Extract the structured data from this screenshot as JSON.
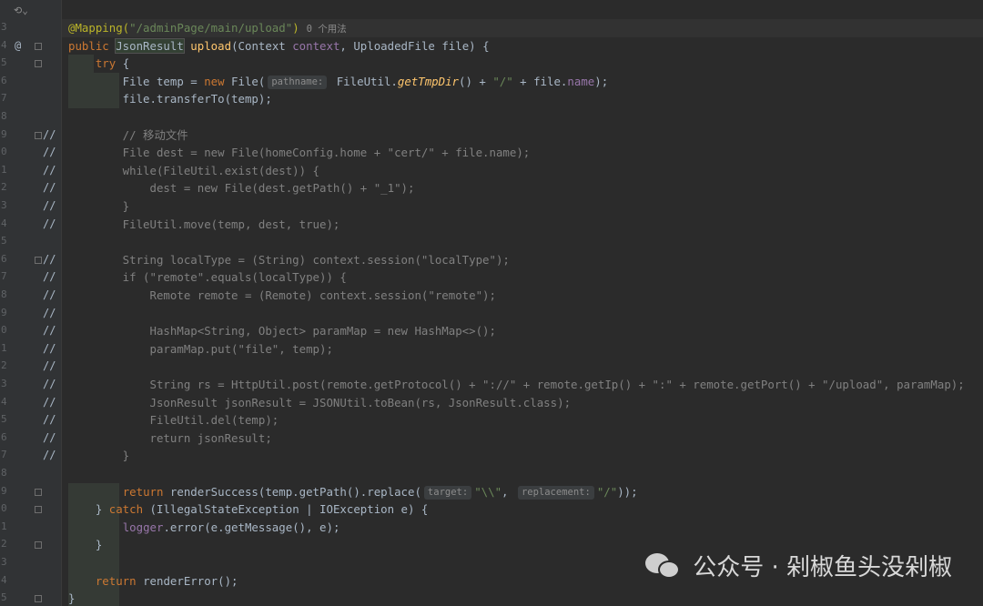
{
  "gutter": {
    "line_numbers": [
      "3",
      "4",
      "5",
      "6",
      "7",
      "7",
      "8",
      "9",
      "0",
      "1",
      "2",
      "3",
      "4",
      "5",
      "6",
      "7",
      "8",
      "9",
      "0",
      "1",
      "2",
      "3",
      "4",
      "5",
      "6",
      "7",
      "8",
      "9",
      "0",
      "1",
      "2",
      "3",
      "4"
    ],
    "at_marker": "@",
    "comment_marker": "//"
  },
  "toolbar": {
    "icon_text": "⟲⌄"
  },
  "lines": [
    {
      "n": "3",
      "parts": [
        [
          "ann",
          "@Mapping("
        ],
        [
          "str",
          "\"/adminPage/main/upload\""
        ],
        [
          "ann",
          ")"
        ],
        [
          "usage",
          "0 个用法"
        ]
      ]
    },
    {
      "n": "4",
      "parts": [
        [
          "kw",
          "public "
        ],
        [
          "hlname",
          "JsonResult"
        ],
        [
          "txt",
          " "
        ],
        [
          "fn",
          "upload"
        ],
        [
          "txt",
          "(Context "
        ],
        [
          "field",
          "context"
        ],
        [
          "txt",
          ", UploadedFile file) {"
        ]
      ]
    },
    {
      "n": "5",
      "parts": [
        [
          "txt",
          "    "
        ],
        [
          "kw",
          "try"
        ],
        [
          "txt",
          " {"
        ]
      ]
    },
    {
      "n": "6",
      "parts": [
        [
          "txt",
          "        File temp = "
        ],
        [
          "kw",
          "new "
        ],
        [
          "txt",
          "File("
        ],
        [
          "hint",
          "pathname:"
        ],
        [
          "txt",
          " FileUtil."
        ],
        [
          "itfn",
          "getTmpDir"
        ],
        [
          "txt",
          "() + "
        ],
        [
          "str",
          "\"/\""
        ],
        [
          "txt",
          " + file."
        ],
        [
          "field",
          "name"
        ],
        [
          "txt",
          ");"
        ]
      ]
    },
    {
      "n": "7",
      "parts": [
        [
          "txt",
          "        file.transferTo(temp);"
        ]
      ]
    },
    {
      "n": "8",
      "parts": [
        [
          "txt",
          ""
        ]
      ]
    },
    {
      "n": "9",
      "parts": [
        [
          "cmt",
          "        // 移动文件"
        ]
      ]
    },
    {
      "n": "0",
      "parts": [
        [
          "cmt",
          "        File dest = new File(homeConfig.home + \"cert/\" + file.name);"
        ]
      ]
    },
    {
      "n": "1",
      "parts": [
        [
          "cmt",
          "        while(FileUtil.exist(dest)) {"
        ]
      ]
    },
    {
      "n": "2",
      "parts": [
        [
          "cmt",
          "            dest = new File(dest.getPath() + \"_1\");"
        ]
      ]
    },
    {
      "n": "3",
      "parts": [
        [
          "cmt",
          "        }"
        ]
      ]
    },
    {
      "n": "4",
      "parts": [
        [
          "cmt",
          "        FileUtil.move(temp, dest, true);"
        ]
      ]
    },
    {
      "n": "5",
      "parts": [
        [
          "txt",
          ""
        ]
      ]
    },
    {
      "n": "6",
      "parts": [
        [
          "cmt",
          "        String localType = (String) context.session(\"localType\");"
        ]
      ]
    },
    {
      "n": "7",
      "parts": [
        [
          "cmt",
          "        if (\"remote\".equals(localType)) {"
        ]
      ]
    },
    {
      "n": "8",
      "parts": [
        [
          "cmt",
          "            Remote remote = (Remote) context.session(\"remote\");"
        ]
      ]
    },
    {
      "n": "9",
      "parts": [
        [
          "txt",
          ""
        ]
      ]
    },
    {
      "n": "0",
      "parts": [
        [
          "cmt",
          "            HashMap<String, Object> paramMap = new HashMap<>();"
        ]
      ]
    },
    {
      "n": "1",
      "parts": [
        [
          "cmt",
          "            paramMap.put(\"file\", temp);"
        ]
      ]
    },
    {
      "n": "2",
      "parts": [
        [
          "txt",
          ""
        ]
      ]
    },
    {
      "n": "3",
      "parts": [
        [
          "cmt",
          "            String rs = HttpUtil.post(remote.getProtocol() + \"://\" + remote.getIp() + \":\" + remote.getPort() + \"/upload\", paramMap);"
        ]
      ]
    },
    {
      "n": "4",
      "parts": [
        [
          "cmt",
          "            JsonResult jsonResult = JSONUtil.toBean(rs, JsonResult.class);"
        ]
      ]
    },
    {
      "n": "5",
      "parts": [
        [
          "cmt",
          "            FileUtil.del(temp);"
        ]
      ]
    },
    {
      "n": "6",
      "parts": [
        [
          "cmt",
          "            return jsonResult;"
        ]
      ]
    },
    {
      "n": "7",
      "parts": [
        [
          "cmt",
          "        }"
        ]
      ]
    },
    {
      "n": "8",
      "parts": [
        [
          "txt",
          ""
        ]
      ]
    },
    {
      "n": "9",
      "parts": [
        [
          "txt",
          "        "
        ],
        [
          "kw",
          "return "
        ],
        [
          "txt",
          "renderSuccess(temp.getPath().replace("
        ],
        [
          "hint",
          "target:"
        ],
        [
          "str",
          "\"\\\\\""
        ],
        [
          "txt",
          ", "
        ],
        [
          "hint",
          "replacement:"
        ],
        [
          "str",
          "\"/\""
        ],
        [
          "txt",
          "));"
        ]
      ]
    },
    {
      "n": "0",
      "parts": [
        [
          "txt",
          "    } "
        ],
        [
          "kw",
          "catch"
        ],
        [
          "txt",
          " (IllegalStateException | IOException e) {"
        ]
      ]
    },
    {
      "n": "1",
      "parts": [
        [
          "txt",
          "        "
        ],
        [
          "field",
          "logger"
        ],
        [
          "txt",
          ".error(e.getMessage(), e);"
        ]
      ]
    },
    {
      "n": "2",
      "parts": [
        [
          "txt",
          "    }"
        ]
      ]
    },
    {
      "n": "3",
      "parts": [
        [
          "txt",
          ""
        ]
      ]
    },
    {
      "n": "4",
      "parts": [
        [
          "txt",
          "    "
        ],
        [
          "kw",
          "return "
        ],
        [
          "txt",
          "renderError();"
        ]
      ]
    },
    {
      "n": "5",
      "parts": [
        [
          "txt",
          "}"
        ]
      ]
    }
  ],
  "comment_lines": [
    6,
    7,
    8,
    9,
    10,
    11,
    13,
    14,
    15,
    16,
    17,
    18,
    19,
    20,
    21,
    22,
    23,
    24
  ],
  "watermark": {
    "text": "公众号 · 剁椒鱼头没剁椒"
  },
  "colors": {
    "background": "#2b2b2b",
    "keyword": "#cc7832",
    "annotation": "#bbb529",
    "string": "#6a8759",
    "method": "#ffc66d",
    "field": "#9876aa",
    "comment": "#808080"
  }
}
